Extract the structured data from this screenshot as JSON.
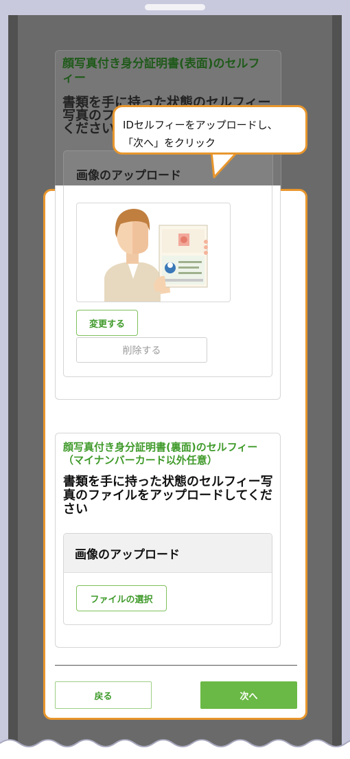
{
  "callout": {
    "text": "IDセルフィーをアップロードし、\n「次へ」をクリック"
  },
  "front_card": {
    "title": "顔写真付き身分証明書(表面)のセルフィー",
    "description": "書類を手に持った状態のセルフィー写真のファイルをアップロードしてください",
    "upload_header": "画像のアップロード",
    "change_button": "変更する",
    "delete_button": "削除する"
  },
  "back_card": {
    "title": "顔写真付き身分証明書(裏面)のセルフィー（マイナンバーカード以外任意）",
    "description": "書類を手に持った状態のセルフィー写真のファイルをアップロードしてください",
    "upload_header": "画像のアップロード",
    "choose_file_button": "ファイルの選択"
  },
  "footer": {
    "back_button": "戻る",
    "next_button": "次へ"
  },
  "dim_visible": {
    "title_line1": "顔写真付き身分証明書(表面)のセルフ",
    "title_line2": "ィー",
    "desc_line1": "書類を手に持った状態のセルフィー",
    "desc_line2": "写真のフ",
    "desc_line3": "ください",
    "upload_header": "画像のアップロード"
  },
  "colors": {
    "accent_orange": "#e8962d",
    "brand_green": "#6ab845"
  }
}
